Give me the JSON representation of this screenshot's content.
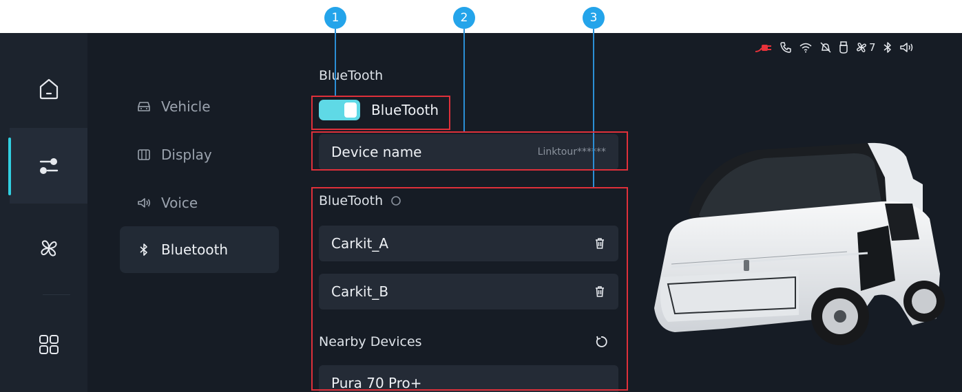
{
  "annotations": [
    {
      "number": "1"
    },
    {
      "number": "2"
    },
    {
      "number": "3"
    }
  ],
  "status_bar": {
    "icons": [
      "charging-plug-icon",
      "phone-icon",
      "wifi-icon",
      "mute-bell-icon",
      "usb-icon",
      "fan-icon",
      "bluetooth-icon",
      "speaker-icon"
    ],
    "fan_level": "7",
    "plug_color": "#e8323a"
  },
  "rail": {
    "items": [
      "home-icon",
      "settings-sliders-icon",
      "fan-icon",
      "apps-grid-icon"
    ],
    "active_index": 1,
    "accent": "#31cfe0"
  },
  "submenu": {
    "items": [
      {
        "label": "Vehicle",
        "icon": "car-icon"
      },
      {
        "label": "Display",
        "icon": "display-icon"
      },
      {
        "label": "Voice",
        "icon": "voice-icon"
      },
      {
        "label": "Bluetooth",
        "icon": "bluetooth-icon"
      }
    ],
    "active_index": 3
  },
  "bluetooth": {
    "title": "BlueTooth",
    "toggle_label": "BlueTooth",
    "toggle_on": true,
    "toggle_color": "#5fd9e6",
    "device_name_label": "Device name",
    "device_name_value": "Linktour******",
    "paired_title": "BlueTooth",
    "paired_devices": [
      {
        "name": "Carkit_A"
      },
      {
        "name": "Carkit_B"
      }
    ],
    "nearby_title": "Nearby Devices",
    "nearby_devices": [
      {
        "name": "Pura 70 Pro+"
      }
    ]
  }
}
